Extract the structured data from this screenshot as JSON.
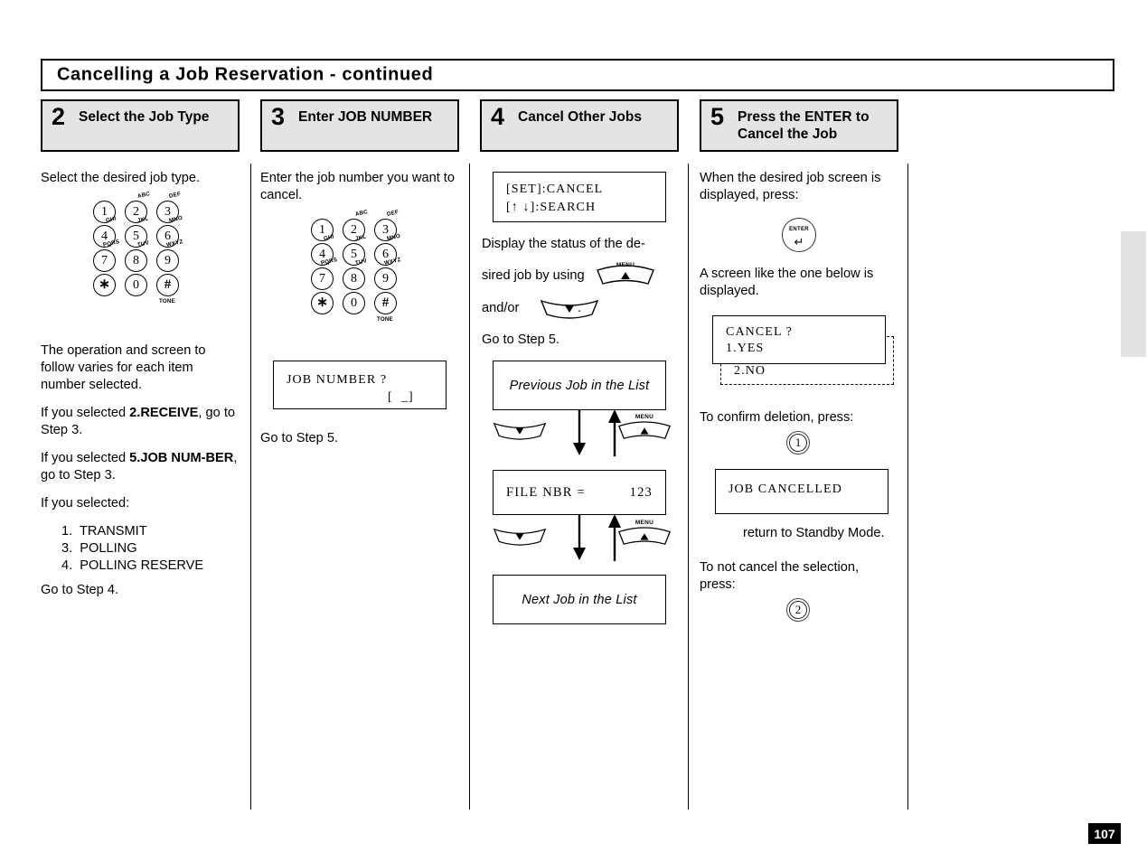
{
  "header": {
    "title": "Cancelling a Job Reservation - continued"
  },
  "page_number": "107",
  "steps": [
    {
      "num": "2",
      "label": "Select the Job Type"
    },
    {
      "num": "3",
      "label": "Enter JOB NUMBER"
    },
    {
      "num": "4",
      "label": "Cancel Other Jobs"
    },
    {
      "num": "5",
      "label": "Press the ENTER to\nCancel the Job"
    }
  ],
  "keypad": {
    "keys": [
      {
        "digit": "1",
        "alpha": ""
      },
      {
        "digit": "2",
        "alpha": "ABC"
      },
      {
        "digit": "3",
        "alpha": "DEF"
      },
      {
        "digit": "4",
        "alpha": "GHI"
      },
      {
        "digit": "5",
        "alpha": "JKL"
      },
      {
        "digit": "6",
        "alpha": "MNO"
      },
      {
        "digit": "7",
        "alpha": "PQRS"
      },
      {
        "digit": "8",
        "alpha": "TUV"
      },
      {
        "digit": "9",
        "alpha": "WXYZ"
      },
      {
        "digit": "∗",
        "alpha": ""
      },
      {
        "digit": "0",
        "alpha": ""
      },
      {
        "digit": "#",
        "alpha": ""
      }
    ],
    "tone_label": "TONE"
  },
  "col2": {
    "intro": "Select the desired job type.",
    "para1": "The operation and screen to follow varies for each item number selected.",
    "para2_pre": "If you selected ",
    "para2_bold": "2.RECEIVE",
    "para2_post": ", go to Step 3.",
    "para3_pre": "If you selected ",
    "para3_bold": "5.JOB NUM-BER",
    "para3_post": ", go to Step 3.",
    "para4": "If you selected:",
    "job_types": [
      "1.  TRANSMIT",
      "3.  POLLING",
      "4.  POLLING RESERVE"
    ],
    "goto": "Go to Step 4."
  },
  "col3": {
    "intro": "Enter the job number you want to cancel.",
    "screen": {
      "line1": "JOB NUMBER ?",
      "line2": "[  _]"
    },
    "goto": "Go to Step 5."
  },
  "col4": {
    "screen": {
      "line1": "[SET]:CANCEL",
      "line2_prefix": "[",
      "line2_up": "↑",
      "line2_down": "↓",
      "line2_suffix": "]:SEARCH"
    },
    "instr_part1": "Display the status of the de-",
    "instr_part2": "sired job by using",
    "instr_part3": "and/or",
    "instr_period": ".",
    "goto": "Go to Step 5.",
    "flow": {
      "box_prev": "Previous Job in the List",
      "lcd_label": "FILE NBR =",
      "lcd_value": "123",
      "box_next": "Next Job in the List",
      "menu_label": "MENU"
    }
  },
  "col5": {
    "para1": "When the desired job screen is displayed,  press:",
    "enter_button": {
      "text": "ENTER",
      "arrow": "↵"
    },
    "para2": "A screen like the one below is displayed.",
    "cancel_screen": {
      "line1": "CANCEL ?",
      "line2": "1.YES",
      "line3": "2.NO"
    },
    "para3": "To confirm deletion, press:",
    "key_yes": "1",
    "cancelled_screen": {
      "line1": "JOB CANCELLED"
    },
    "standby": "return to Standby Mode.",
    "para4": "To not cancel the selection, press:",
    "key_no": "2"
  }
}
